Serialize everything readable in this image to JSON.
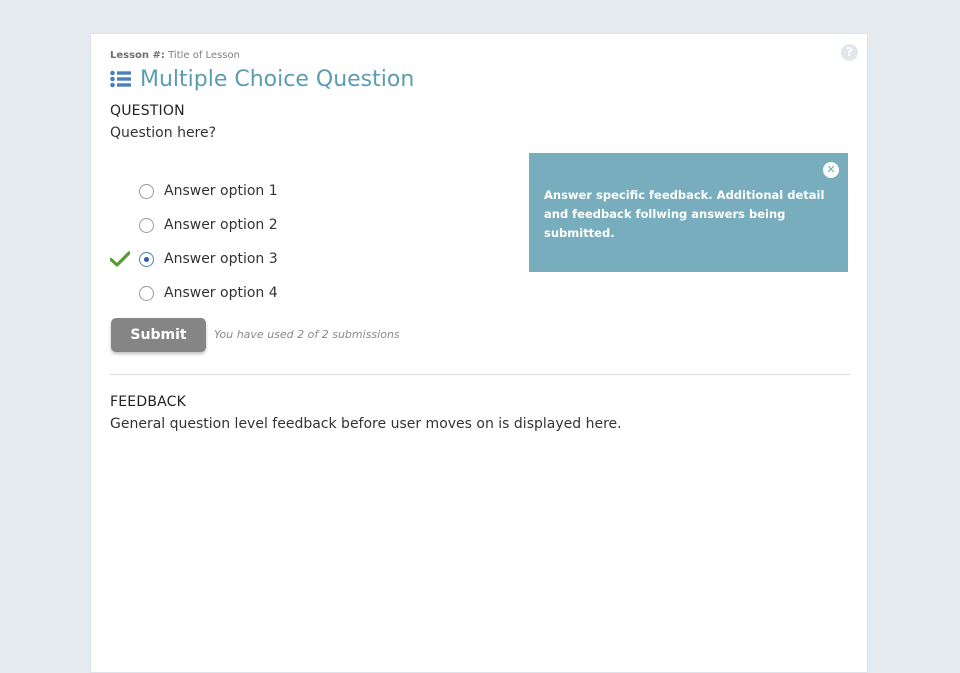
{
  "lesson": {
    "label": "Lesson #:",
    "title": "Title of Lesson"
  },
  "page": {
    "title": "Multiple Choice Question",
    "title_color": "#5c9cb3"
  },
  "question": {
    "heading": "QUESTION",
    "text": "Question here?"
  },
  "answers": [
    {
      "label": "Answer option 1",
      "selected": false,
      "correct_mark": false
    },
    {
      "label": "Answer option 2",
      "selected": false,
      "correct_mark": false
    },
    {
      "label": "Answer option 3",
      "selected": true,
      "correct_mark": true
    },
    {
      "label": "Answer option 4",
      "selected": false,
      "correct_mark": false
    }
  ],
  "submit": {
    "label": "Submit",
    "note": "You have used 2 of 2 submissions"
  },
  "popup": {
    "text": "Answer specific feedback. Additional detail and feedback follwing answers being submitted.",
    "background": "#77adbc",
    "close_icon": "close-circle-icon"
  },
  "feedback": {
    "heading": "FEEDBACK",
    "text": "General question level feedback before user moves on is displayed here."
  },
  "icons": {
    "help": "question-circle-icon",
    "title": "list-icon",
    "check": "checkmark-icon"
  },
  "colors": {
    "check": "#5a9a2e",
    "submit_bg": "#858585",
    "page_bg": "#e5eaef"
  }
}
